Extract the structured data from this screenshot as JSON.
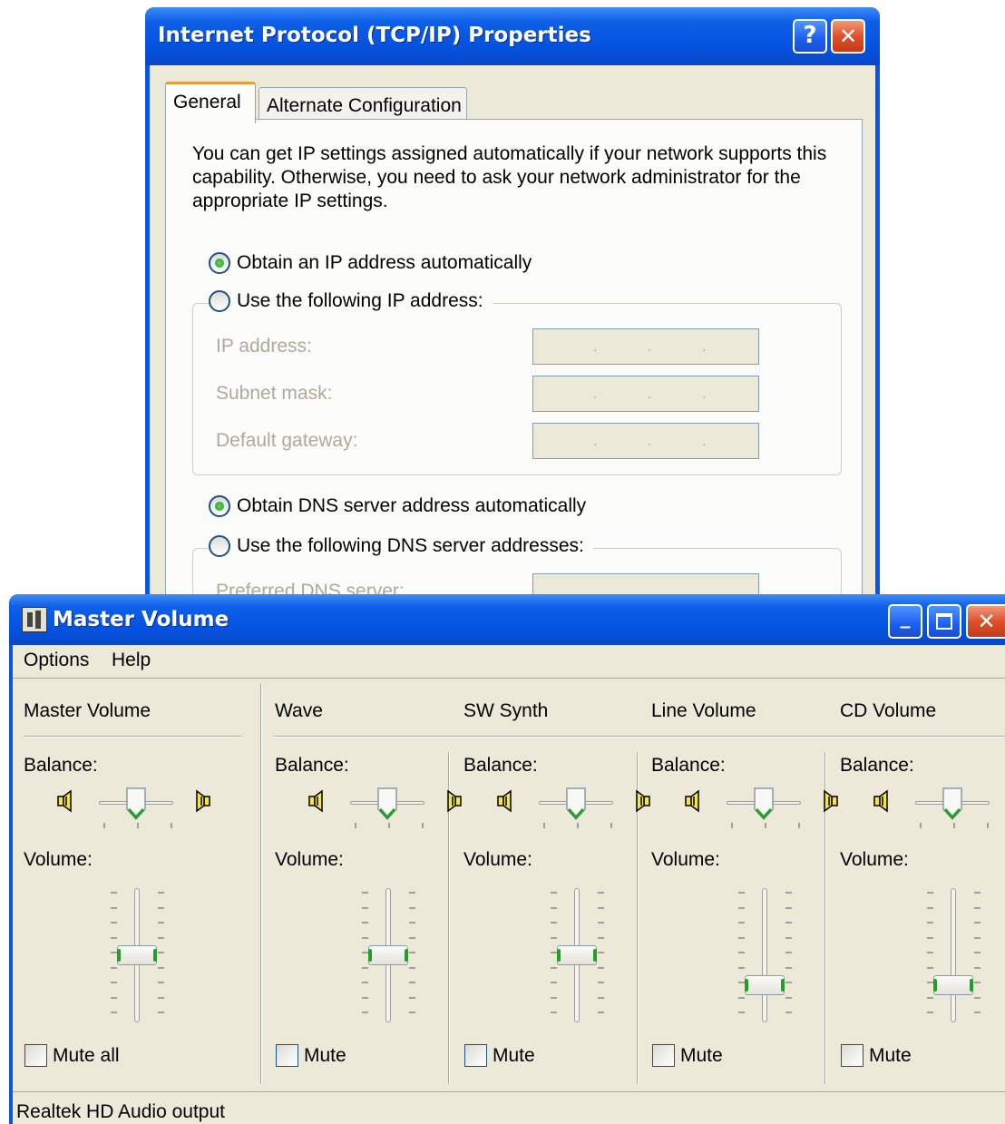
{
  "tcp_window": {
    "title": "Internet Protocol (TCP/IP) Properties",
    "help_glyph": "?",
    "close_glyph": "✕",
    "tabs": [
      {
        "label": "General",
        "active": true
      },
      {
        "label": "Alternate Configuration",
        "active": false
      }
    ],
    "description": "You can get IP settings assigned automatically if your network supports this capability. Otherwise, you need to ask your network administrator for the appropriate IP settings.",
    "ip_mode": {
      "auto_label": "Obtain an IP address automatically",
      "manual_label": "Use the following IP address:",
      "selected": "auto"
    },
    "ip_fields": [
      {
        "label": "IP address:",
        "value": ". . ."
      },
      {
        "label": "Subnet mask:",
        "value": ". . ."
      },
      {
        "label": "Default gateway:",
        "value": ". . ."
      }
    ],
    "dns_mode": {
      "auto_label": "Obtain DNS server address automatically",
      "manual_label": "Use the following DNS server addresses:",
      "selected": "auto"
    },
    "dns_fields": [
      {
        "label": "Preferred DNS server:",
        "value": ". . ."
      }
    ]
  },
  "volume_window": {
    "title": "Master Volume",
    "minimize_glyph": "_",
    "close_glyph": "✕",
    "menu": [
      "Options",
      "Help"
    ],
    "balance_label": "Balance:",
    "volume_label": "Volume:",
    "channels": [
      {
        "name": "Master Volume",
        "mute_label": "Mute all",
        "volume_level": 0.5,
        "balance": 0.5,
        "muted": false
      },
      {
        "name": "Wave",
        "mute_label": "Mute",
        "volume_level": 0.5,
        "balance": 0.5,
        "muted": false
      },
      {
        "name": "SW Synth",
        "mute_label": "Mute",
        "volume_level": 0.5,
        "balance": 0.5,
        "muted": false
      },
      {
        "name": "Line Volume",
        "mute_label": "Mute",
        "volume_level": 0.28,
        "balance": 0.5,
        "muted": false
      },
      {
        "name": "CD Volume",
        "mute_label": "Mute",
        "volume_level": 0.28,
        "balance": 0.5,
        "muted": false
      }
    ],
    "status": "Realtek HD Audio output"
  },
  "colors": {
    "titlebar": "#0a55e4",
    "face": "#ece9d8",
    "close_red": "#e0502c",
    "radio_green": "#21a121"
  }
}
